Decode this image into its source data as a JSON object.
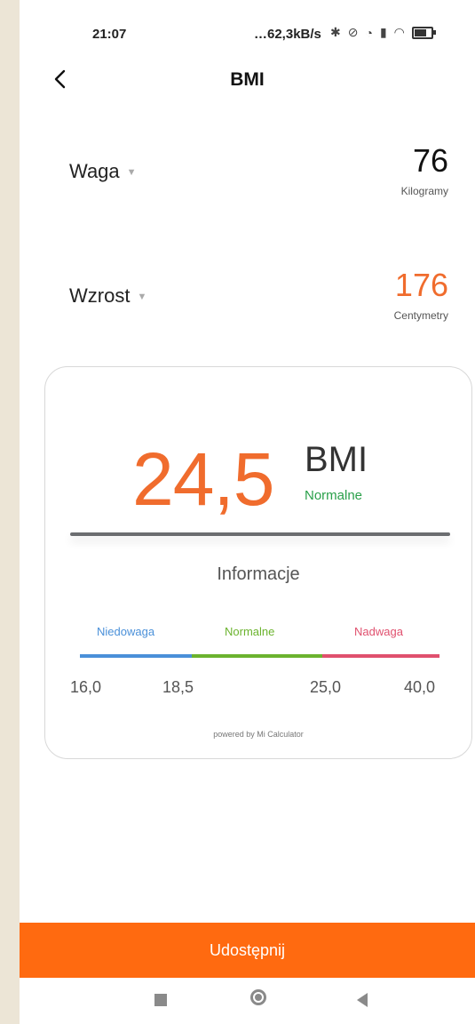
{
  "status_bar": {
    "time": "21:07",
    "network_rate": "…62,3kB/s",
    "icons": [
      "bluetooth-icon",
      "mute-icon",
      "alarm-icon",
      "signal-icon",
      "wifi-icon",
      "battery-icon"
    ]
  },
  "header": {
    "title": "BMI",
    "back_icon": "chevron-left-icon"
  },
  "inputs": {
    "weight": {
      "label": "Waga",
      "value": "76",
      "unit": "Kilogramy",
      "value_color": "#111111"
    },
    "height": {
      "label": "Wzrost",
      "value": "176",
      "unit": "Centymetry",
      "value_color": "#f06c2d"
    }
  },
  "result": {
    "bmi_value": "24,5",
    "bmi_unit": "BMI",
    "status": "Normalne",
    "value_color": "#f06c2d",
    "status_color": "#2aa04a"
  },
  "info": {
    "title": "Informacje",
    "categories": [
      {
        "label": "Niedowaga",
        "color": "#4a90d9"
      },
      {
        "label": "Normalne",
        "color": "#6bb32e"
      },
      {
        "label": "Nadwaga",
        "color": "#e0506e"
      }
    ],
    "ticks": [
      "16,0",
      "18,5",
      "25,0",
      "40,0"
    ],
    "powered_by": "powered by Mi Calculator"
  },
  "actions": {
    "share_label": "Udostępnij",
    "share_color": "#ff6a10"
  },
  "nav": {
    "icons": [
      "recents-square-icon",
      "home-circle-icon",
      "back-triangle-icon"
    ]
  }
}
